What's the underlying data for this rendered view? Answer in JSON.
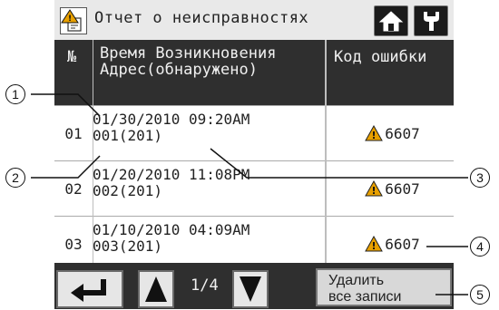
{
  "title": "Отчет о неисправностях",
  "header": {
    "no_label": "№",
    "time_line1": "Время Возникновения",
    "time_line2": "Адрес(обнаружено)",
    "code_label": "Код ошибки"
  },
  "rows": [
    {
      "no": "01",
      "datetime": "01/30/2010 09:20AM",
      "address": "001(201)",
      "code": "6607"
    },
    {
      "no": "02",
      "datetime": "01/20/2010 11:08PM",
      "address": "002(201)",
      "code": "6607"
    },
    {
      "no": "03",
      "datetime": "01/10/2010 04:09AM",
      "address": "003(201)",
      "code": "6607"
    }
  ],
  "pagination": {
    "indicator": "1/4"
  },
  "delete_button": {
    "line1": "Удалить",
    "line2": "все записи"
  },
  "callouts": [
    "1",
    "2",
    "3",
    "4",
    "5"
  ],
  "icons": {
    "title": "fault-report-icon",
    "home": "home-icon",
    "maintenance": "wrench-icon",
    "warning": "warning-icon",
    "back": "return-arrow-icon",
    "up": "up-arrow-icon",
    "down": "down-arrow-icon"
  },
  "colors": {
    "warning": "#e8a000",
    "panel": "#2f2f2f"
  }
}
